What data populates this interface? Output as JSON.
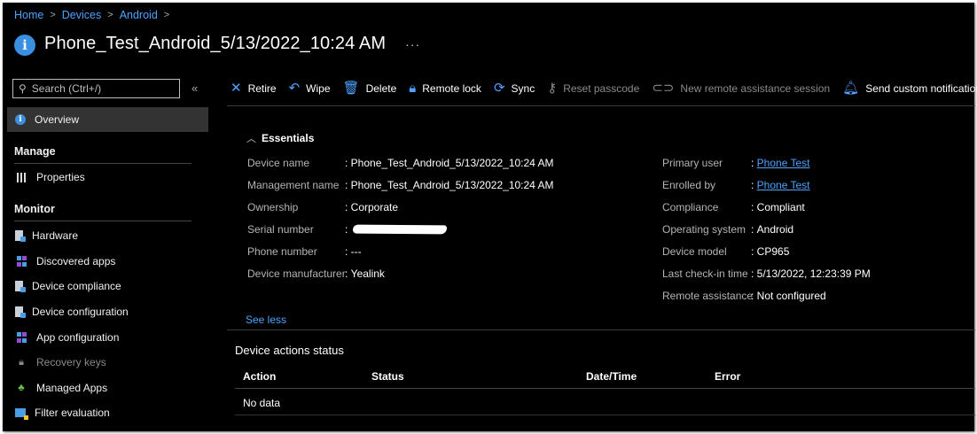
{
  "breadcrumb": [
    "Home",
    "Devices",
    "Android"
  ],
  "title": "Phone_Test_Android_5/13/2022_10:24 AM",
  "more_label": "···",
  "search": {
    "placeholder": "Search (Ctrl+/)"
  },
  "collapse_label": "«",
  "sidebar": {
    "overview": "Overview",
    "manage_header": "Manage",
    "properties": "Properties",
    "monitor_header": "Monitor",
    "monitor_items": [
      "Hardware",
      "Discovered apps",
      "Device compliance",
      "Device configuration",
      "App configuration",
      "Recovery keys",
      "Managed Apps",
      "Filter evaluation"
    ]
  },
  "toolbar": [
    {
      "label": "Retire",
      "icon": "close-icon"
    },
    {
      "label": "Wipe",
      "icon": "undo-icon"
    },
    {
      "label": "Delete",
      "icon": "trash-icon"
    },
    {
      "label": "Remote lock",
      "icon": "lock-icon"
    },
    {
      "label": "Sync",
      "icon": "sync-icon"
    },
    {
      "label": "Reset passcode",
      "icon": "key-icon",
      "disabled": true
    },
    {
      "label": "New remote assistance session",
      "icon": "link-icon",
      "disabled": true
    },
    {
      "label": "Send custom notification",
      "icon": "bell-icon"
    }
  ],
  "essentials": {
    "header": "Essentials",
    "left": [
      {
        "key": "Device name",
        "value": "Phone_Test_Android_5/13/2022_10:24 AM"
      },
      {
        "key": "Management name",
        "value": "Phone_Test_Android_5/13/2022_10:24 AM"
      },
      {
        "key": "Ownership",
        "value": "Corporate"
      },
      {
        "key": "Serial number",
        "value": ""
      },
      {
        "key": "Phone number",
        "value": "---"
      },
      {
        "key": "Device manufacturer",
        "value": "Yealink"
      }
    ],
    "right": [
      {
        "key": "Primary user",
        "value": "Phone Test"
      },
      {
        "key": "Enrolled by",
        "value": "Phone Test"
      },
      {
        "key": "Compliance",
        "value": "Compliant"
      },
      {
        "key": "Operating system",
        "value": "Android"
      },
      {
        "key": "Device model",
        "value": "CP965"
      },
      {
        "key": "Last check-in time",
        "value": "5/13/2022, 12:23:39 PM"
      },
      {
        "key": "Remote assistance",
        "value": "Not configured"
      }
    ],
    "see_less": "See less"
  },
  "device_actions": {
    "title": "Device actions status",
    "columns": [
      "Action",
      "Status",
      "Date/Time",
      "Error"
    ],
    "empty_text": "No data"
  },
  "colors": {
    "accent": "#4da3ff",
    "background": "#000000",
    "selected": "#333333"
  }
}
